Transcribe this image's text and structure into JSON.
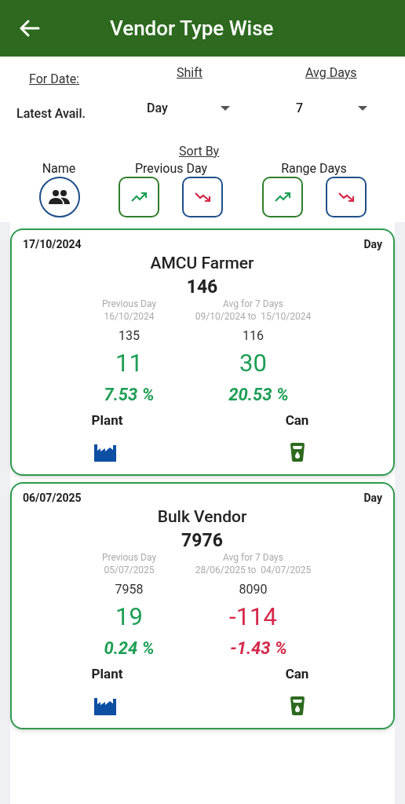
{
  "header": {
    "title": "Vendor Type Wise"
  },
  "filters": {
    "for_date_label": "For Date:",
    "for_date_value": "Latest Avail.",
    "shift_label": "Shift",
    "shift_value": "Day",
    "avg_days_label": "Avg Days",
    "avg_days_value": "7"
  },
  "sort": {
    "title": "Sort By",
    "groups": [
      {
        "label": "Name",
        "buttons": [
          {
            "kind": "people"
          }
        ]
      },
      {
        "label": "Previous Day",
        "buttons": [
          {
            "kind": "up"
          },
          {
            "kind": "down"
          }
        ]
      },
      {
        "label": "Range Days",
        "buttons": [
          {
            "kind": "up"
          },
          {
            "kind": "down"
          }
        ]
      }
    ]
  },
  "cards": [
    {
      "date": "17/10/2024",
      "shift": "Day",
      "name": "AMCU Farmer",
      "total": "146",
      "prev_label": "Previous Day",
      "prev_date": "16/10/2024",
      "prev_value": "135",
      "prev_delta": "11",
      "prev_pct": "7.53 %",
      "prev_negative": false,
      "avg_label": "Avg for 7 Days",
      "avg_range": "09/10/2024 to  15/10/2024",
      "avg_value": "116",
      "avg_delta": "30",
      "avg_pct": "20.53 %",
      "avg_negative": false,
      "left_label": "Plant",
      "right_label": "Can"
    },
    {
      "date": "06/07/2025",
      "shift": "Day",
      "name": "Bulk Vendor",
      "total": "7976",
      "prev_label": "Previous Day",
      "prev_date": "05/07/2025",
      "prev_value": "7958",
      "prev_delta": "19",
      "prev_pct": "0.24 %",
      "prev_negative": false,
      "avg_label": "Avg for 7 Days",
      "avg_range": "28/06/2025 to  04/07/2025",
      "avg_value": "8090",
      "avg_delta": "-114",
      "avg_pct": "-1.43 %",
      "avg_negative": true,
      "left_label": "Plant",
      "right_label": "Can"
    }
  ]
}
